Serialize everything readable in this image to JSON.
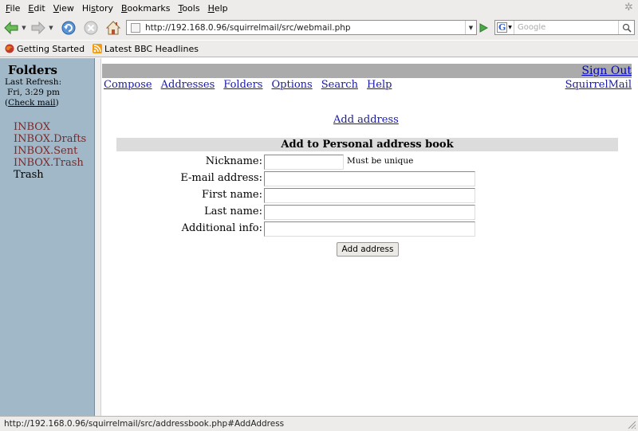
{
  "browser": {
    "menu": [
      {
        "accel": "F",
        "rest": "ile"
      },
      {
        "accel": "E",
        "rest": "dit"
      },
      {
        "accel": "V",
        "rest": "iew"
      },
      {
        "pre": "Hi",
        "accel": "s",
        "rest": "tory"
      },
      {
        "accel": "B",
        "rest": "ookmarks"
      },
      {
        "accel": "T",
        "rest": "ools"
      },
      {
        "accel": "H",
        "rest": "elp"
      }
    ],
    "url": "http://192.168.0.96/squirrelmail/src/webmail.php",
    "search_placeholder": "Google",
    "bookmarks": [
      "Getting Started",
      "Latest BBC Headlines"
    ],
    "status_text": "http://192.168.0.96/squirrelmail/src/addressbook.php#AddAddress",
    "colors": {
      "back_arrow": "#3a9a3a",
      "reload": "#3b7ac0",
      "stop": "#b8b8b8",
      "go": "#3a9a3a"
    }
  },
  "sidebar": {
    "title": "Folders",
    "refresh_label": "Last Refresh:",
    "refresh_time": "Fri, 3:29 pm",
    "check_mail": "Check mail",
    "folders": [
      {
        "name": "INBOX",
        "link": true
      },
      {
        "name": "INBOX.Drafts",
        "link": true
      },
      {
        "name": "INBOX.Sent",
        "link": true
      },
      {
        "name": "INBOX.Trash",
        "link": true
      },
      {
        "name": "Trash",
        "link": false
      }
    ]
  },
  "main": {
    "sign_out": "Sign Out",
    "nav": [
      "Compose",
      "Addresses",
      "Folders",
      "Options",
      "Search",
      "Help"
    ],
    "brand": "SquirrelMail",
    "add_address_link": "Add address",
    "form_title": "Add to Personal address book",
    "fields": [
      {
        "label": "Nickname:",
        "value": ""
      },
      {
        "label": "E-mail address:",
        "value": ""
      },
      {
        "label": "First name:",
        "value": ""
      },
      {
        "label": "Last name:",
        "value": ""
      },
      {
        "label": "Additional info:",
        "value": ""
      }
    ],
    "nickname_hint": "Must be unique",
    "submit": "Add address"
  }
}
